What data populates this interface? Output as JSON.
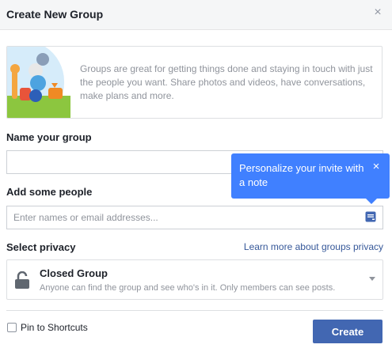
{
  "header": {
    "title": "Create New Group",
    "close_icon": "close-icon",
    "close_glyph": "×"
  },
  "intro": {
    "illustration": "group-animals-illustration",
    "text": "Groups are great for getting things done and staying in touch with just the people you want. Share photos and videos, have conversations, make plans and more."
  },
  "name_section": {
    "label": "Name your group",
    "value": ""
  },
  "people_section": {
    "label": "Add some people",
    "placeholder": "Enter names or email addresses...",
    "note_icon": "note-icon"
  },
  "tooltip": {
    "text": "Personalize your invite with a note",
    "close_glyph": "×"
  },
  "privacy_section": {
    "label": "Select privacy",
    "learn_more": "Learn more about groups privacy",
    "selected": {
      "name": "Closed Group",
      "description": "Anyone can find the group and see who's in it. Only members can see posts.",
      "icon": "lock-icon"
    }
  },
  "footer": {
    "pin_label": "Pin to Shortcuts",
    "pin_checked": false,
    "create_label": "Create"
  },
  "colors": {
    "primary": "#4267b2",
    "tooltip": "#4080ff",
    "link": "#365899",
    "muted_text": "#90949c",
    "border": "#dddfe2"
  }
}
